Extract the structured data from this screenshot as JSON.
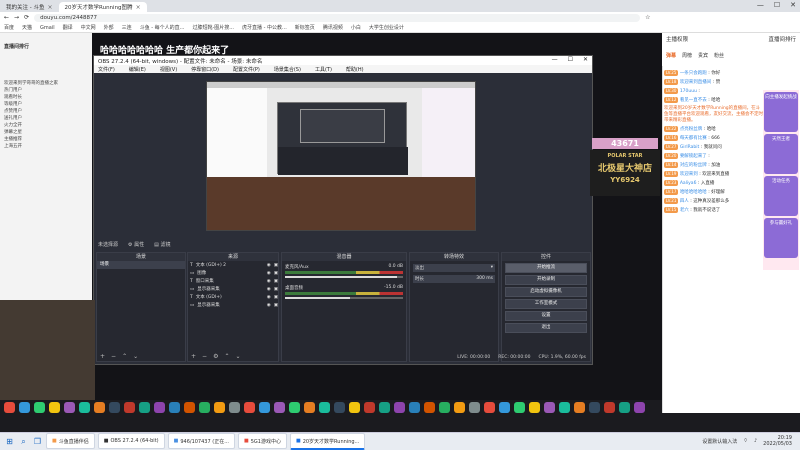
{
  "browser": {
    "tabs": [
      {
        "label": "我的关注 - 斗鱼",
        "active": false
      },
      {
        "label": "20岁天才数学Running图腾",
        "active": true
      }
    ],
    "url": "douyu.com/2448877",
    "bookmarks": [
      "百度",
      "天猫",
      "Gmail",
      "翻译",
      "中文网",
      "外部",
      "三连",
      "斗鱼 - 每个人的直...",
      "过膝短靴-图片搜...",
      "虎牙直播 - 中公教...",
      "新标签页",
      "腾讯视频",
      "小白",
      "大学生创业设计"
    ],
    "window_controls": [
      "—",
      "☐",
      "✕"
    ]
  },
  "stream": {
    "title": "哈哈哈哈哈哈哈 生产都你起来了",
    "counter": "43671",
    "banner_top": "POLAR STAR",
    "banner_main": "北极星大神店",
    "banner_sub": "YY6924"
  },
  "left_chat": {
    "header": "直播间排行",
    "items": [
      "欢迎来到学哥哥的直播之家",
      "热门用户",
      "观看时长",
      "等级用户",
      "点赞用户",
      "送礼用户",
      "火力全开",
      "弹幕之星",
      "主播推荐",
      "上海五开"
    ]
  },
  "obs": {
    "title": "OBS 27.2.4 (64-bit, windows) - 配置文件: 未命名 - 场景: 未命名",
    "menu": [
      "文件(F)",
      "编辑(E)",
      "视图(V)",
      "停靠窗口(D)",
      "配置文件(P)",
      "场景集合(S)",
      "工具(T)",
      "帮助(H)"
    ],
    "source_bar": [
      "未选择源",
      "属性",
      "滤镜"
    ],
    "docks": {
      "scenes": {
        "title": "场景",
        "items": [
          "场景"
        ]
      },
      "sources": {
        "title": "来源",
        "items": [
          "文本 (GDI+) 2",
          "图像",
          "窗口采集",
          "显示器采集",
          "文本 (GDI+)",
          "显示器采集"
        ]
      },
      "mixer": {
        "title": "混音器",
        "channels": [
          {
            "name": "麦克风/Aux",
            "db": "0.0 dB"
          },
          {
            "name": "桌面音频",
            "db": "-15.0 dB"
          }
        ]
      },
      "transitions": {
        "title": "转场特效",
        "type": "淡出",
        "duration_label": "时长",
        "duration": "300 ms"
      },
      "controls": {
        "title": "控件",
        "buttons": [
          "开始推流",
          "开始录制",
          "启动虚拟摄像机",
          "工作室模式",
          "设置",
          "退出"
        ]
      }
    },
    "status": [
      "LIVE: 00:00:00",
      "REC: 00:00:00",
      "CPU: 1.9%, 60.00 fps"
    ]
  },
  "right_panel": {
    "header_left": "主播权限",
    "header_right": "直播间排行",
    "tabs": [
      "弹幕",
      "周榜",
      "贵宾",
      "粉丝"
    ],
    "messages": [
      {
        "badge": "LV.25",
        "user": "一条只会跑跑",
        "text": "你好"
      },
      {
        "badge": "LV.18",
        "user": "欢迎来到直播间",
        "text": "赞"
      },
      {
        "badge": "LV.30",
        "user": "170uuu",
        "text": ""
      },
      {
        "badge": "LV.12",
        "user": "看见一直不去",
        "text": "哈哈"
      },
      {
        "system": true,
        "text": "欢迎来到20岁天才数学Running的直播间，在斗鱼等直播平台欢迎观看，友好交流，主播会不定时带来精彩直播。"
      },
      {
        "badge": "LV.22",
        "user": "点亮粉丝牌",
        "text": "哈哈"
      },
      {
        "badge": "LV.16",
        "user": "每天都有比赛",
        "text": "666"
      },
      {
        "badge": "LV.27",
        "user": "GirlRabit",
        "text": "我就问问"
      },
      {
        "badge": "LV.20",
        "user": "要解锁起来了",
        "text": ""
      },
      {
        "badge": "LV.14",
        "user": "对应的粉丝牌",
        "text": "加油"
      },
      {
        "badge": "LV.19",
        "user": "欢迎来到",
        "text": "欢迎来到直播"
      },
      {
        "badge": "LV.23",
        "user": "Aaliya6",
        "text": "入直播"
      },
      {
        "badge": "LV.17",
        "user": "哈哈哈哈哈哈",
        "text": "好理解"
      },
      {
        "badge": "LV.21",
        "user": "四人",
        "text": "这种真没差那么多"
      },
      {
        "badge": "LV.15",
        "user": "老六",
        "text": "我就不说话了"
      }
    ],
    "promos": [
      "向主播发起挑战",
      "天然王者",
      "活动任务",
      "参与赢好礼"
    ]
  },
  "taskbar": {
    "apps": [
      "斗鱼直播伴侣",
      "OBS 27.2.4 (64-bit)",
      "946/107437 (正在...",
      "5G1游戏中心",
      "20岁天才数学Running..."
    ],
    "tray_text": "设置默认输入法",
    "time": "20:19",
    "date": "2022/05/03"
  },
  "colors": {
    "obs_bg": "#2b2e38",
    "accent": "#1a73e8",
    "system_msg": "#e96d2c",
    "counter_bg": "#d8a0c8"
  }
}
